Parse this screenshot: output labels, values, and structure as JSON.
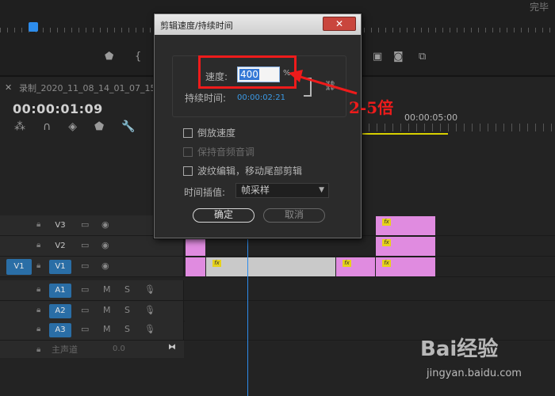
{
  "source_monitor": {
    "done_label": "完毕"
  },
  "sequence": {
    "name": "录制_2020_11_08_14_01_07_152",
    "timecode": "00:00:01:09",
    "ruler_time": "00:00:05:00"
  },
  "tracks": {
    "video": [
      {
        "name": "V3"
      },
      {
        "name": "V2"
      },
      {
        "name": "V1",
        "source_patch": "V1"
      }
    ],
    "audio": [
      {
        "name": "A1",
        "mute": "M",
        "solo": "S"
      },
      {
        "name": "A2",
        "mute": "M",
        "solo": "S"
      },
      {
        "name": "A3",
        "mute": "M",
        "solo": "S"
      }
    ],
    "master": {
      "label": "主声道",
      "value": "0.0"
    }
  },
  "dialog": {
    "title": "剪辑速度/持续时间",
    "close_glyph": "✕",
    "speed_label": "速度:",
    "speed_value": "400",
    "speed_unit": "%",
    "duration_label": "持续时间:",
    "duration_value": "00:00:02:21",
    "reverse_label": "倒放速度",
    "maintain_pitch_label": "保持音频音调",
    "ripple_label": "波纹编辑，移动尾部剪辑",
    "interp_label": "时间插值:",
    "interp_value": "帧采样",
    "ok_label": "确定",
    "cancel_label": "取消"
  },
  "annotation": {
    "text": "2-5倍",
    "color": "#ee1b1b"
  },
  "watermark": {
    "brand": "Bai经验",
    "url": "jingyan.baidu.com"
  },
  "colors": {
    "accent_blue": "#2d8ceb",
    "clip_pink": "#e08be0",
    "clip_gray": "#c9c9c9",
    "track_target": "#2a6ea6"
  },
  "icons": [
    "marker-icon",
    "wrench-icon",
    "snap-icon",
    "link-icon",
    "eye-icon",
    "camera-icon",
    "lock-icon",
    "mic-icon",
    "fx-badge-icon"
  ]
}
